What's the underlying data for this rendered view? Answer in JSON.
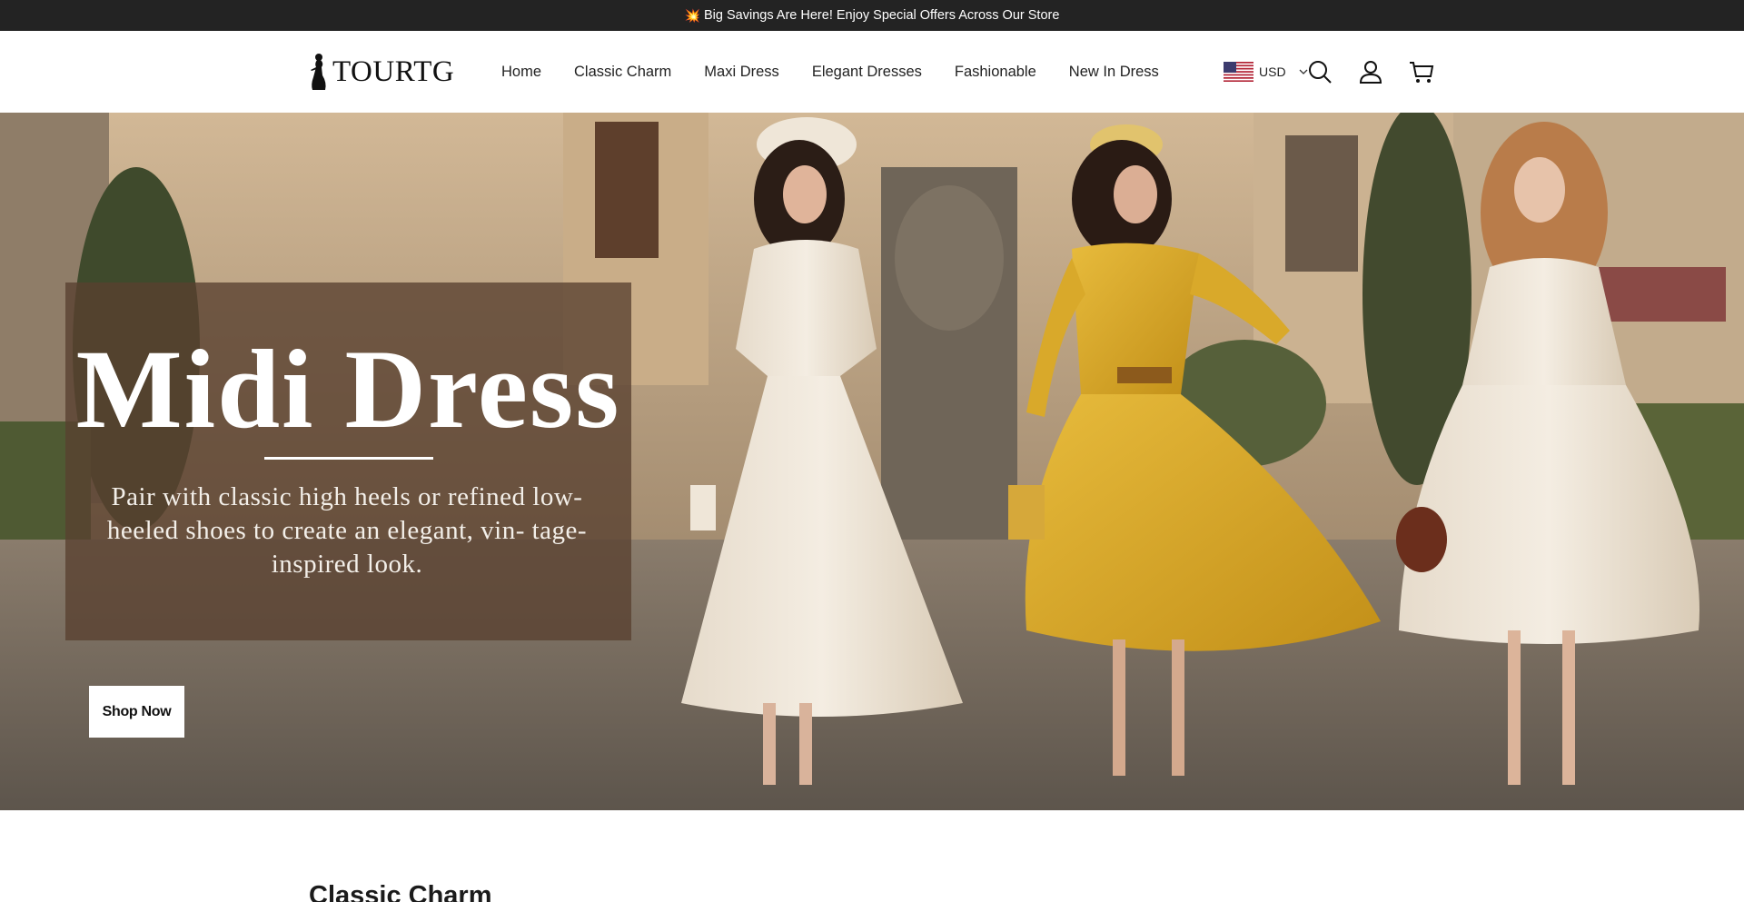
{
  "announcement": {
    "icon": "sparkle-icon",
    "emoji": "💥",
    "text": "Big Savings Are Here! Enjoy Special Offers Across Our Store"
  },
  "header": {
    "logo_text": "TOURTG",
    "nav": [
      "Home",
      "Classic Charm",
      "Maxi Dress",
      "Elegant Dresses",
      "Fashionable",
      "New In Dress"
    ],
    "currency": {
      "code": "USD",
      "flag": "us-flag-icon"
    },
    "icons": [
      "search-icon",
      "account-icon",
      "cart-icon"
    ]
  },
  "hero": {
    "title": "Midi Dress",
    "subtitle": "Pair with classic high heels or refined low-heeled shoes to create an elegant, vin- tage-inspired look.",
    "cta": "Shop Now"
  },
  "sections": {
    "next_title": "Classic Charm"
  },
  "colors": {
    "announce_bg": "#232323",
    "overlay": "#584030",
    "white": "#ffffff",
    "yellow_dress": "#d9a92a",
    "cream_dress": "#ece3d6"
  }
}
